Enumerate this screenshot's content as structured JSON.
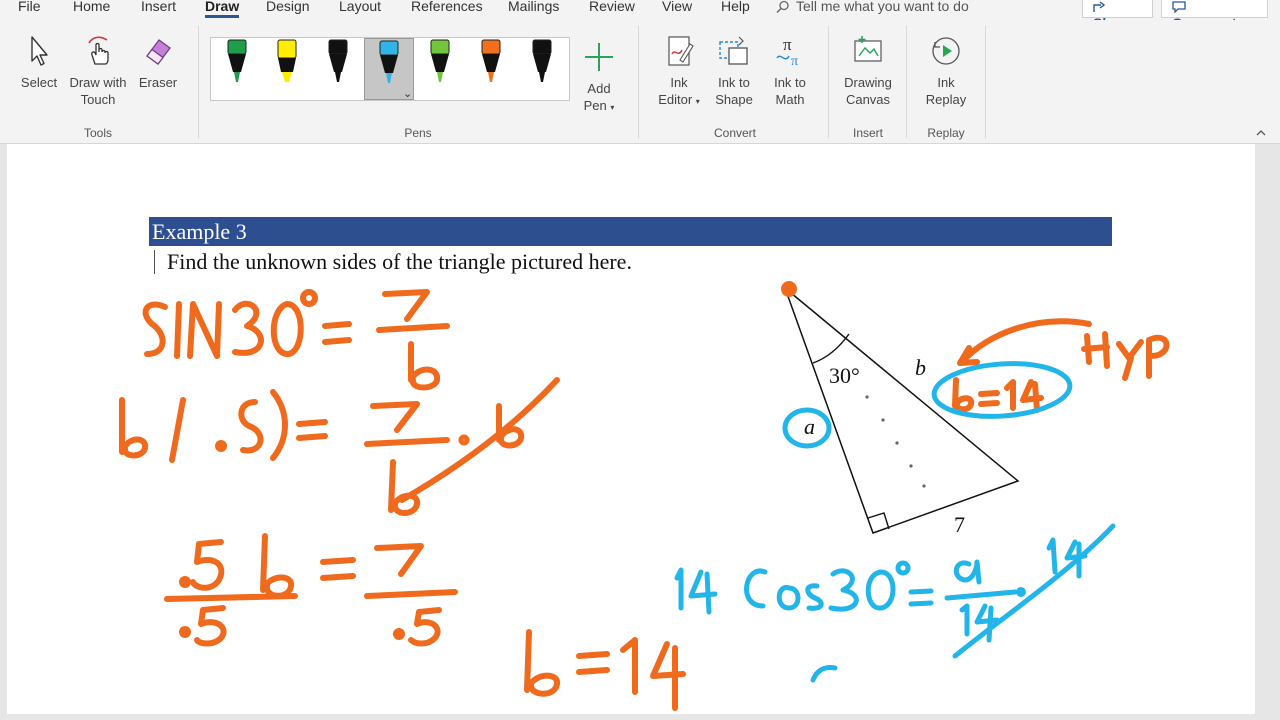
{
  "menu": {
    "tabs": [
      "File",
      "Home",
      "Insert",
      "Draw",
      "Design",
      "Layout",
      "References",
      "Mailings",
      "Review",
      "View",
      "Help"
    ],
    "active_tab": "Draw",
    "tell_me": "Tell me what you want to do",
    "share": "Share",
    "comments": "Comments"
  },
  "ribbon": {
    "tools": {
      "select": "Select",
      "draw_touch_1": "Draw with",
      "draw_touch_2": "Touch",
      "eraser": "Eraser",
      "group": "Tools"
    },
    "pens": {
      "group": "Pens",
      "colors": [
        "#1e9e4a",
        "#ffee00",
        "#111111",
        "#2fb5e8",
        "#72c63b",
        "#f07020",
        "#111111"
      ],
      "selected_index": 3
    },
    "add_pen_1": "Add",
    "add_pen_2": "Pen",
    "convert": {
      "ink_editor_1": "Ink",
      "ink_editor_2": "Editor",
      "ink_shape_1": "Ink to",
      "ink_shape_2": "Shape",
      "ink_math_1": "Ink to",
      "ink_math_2": "Math",
      "group": "Convert"
    },
    "insert": {
      "canvas_1": "Drawing",
      "canvas_2": "Canvas",
      "group": "Insert"
    },
    "replay": {
      "ink_replay_1": "Ink",
      "ink_replay_2": "Replay",
      "group": "Replay"
    }
  },
  "document": {
    "example_title": "Example 3",
    "prompt": "Find the unknown sides of the triangle pictured here.",
    "triangle": {
      "angle": "30°",
      "side_b": "b",
      "side_a": "a",
      "side_bottom": "7"
    }
  },
  "ink_colors": {
    "orange": "#f06a1e",
    "blue": "#22b5ea"
  }
}
